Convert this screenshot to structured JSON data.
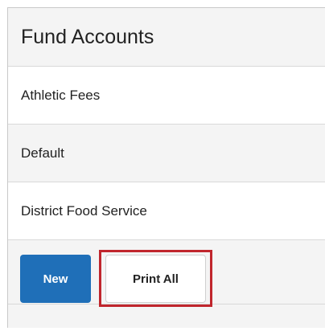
{
  "header": {
    "title": "Fund Accounts"
  },
  "accounts": [
    {
      "label": "Athletic Fees"
    },
    {
      "label": "Default"
    },
    {
      "label": "District Food Service"
    }
  ],
  "actions": {
    "new_label": "New",
    "print_all_label": "Print All"
  },
  "colors": {
    "primary_button": "#1f6fb8",
    "highlight_border": "#c0262d"
  }
}
